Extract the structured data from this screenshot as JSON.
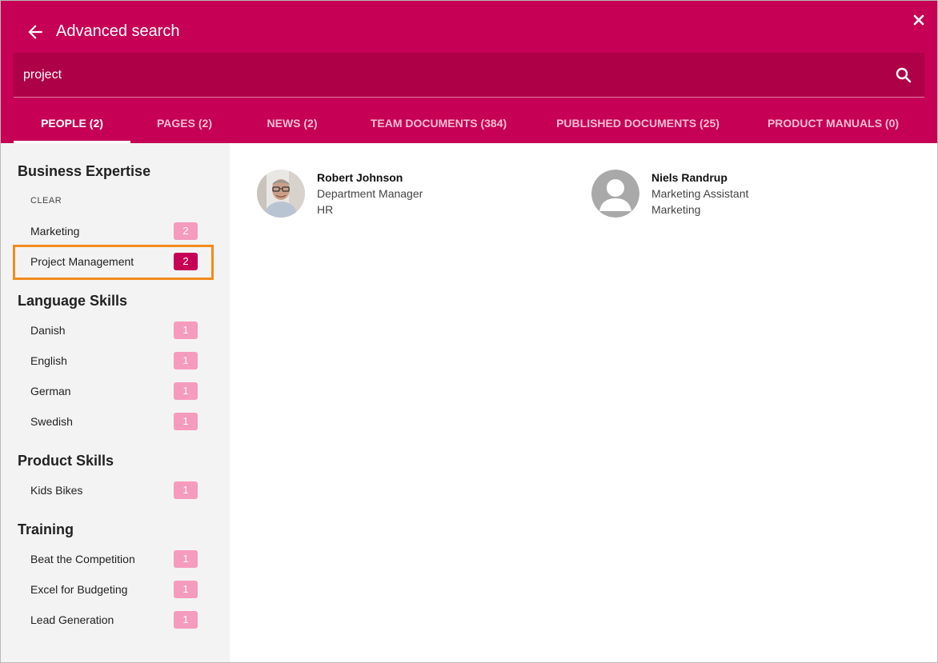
{
  "header": {
    "title": "Advanced search",
    "background_color": "#c50055",
    "back_icon": "arrow-left-icon",
    "close_icon": "close-icon"
  },
  "search": {
    "value": "project",
    "icon": "search-icon"
  },
  "tabs": [
    {
      "label": "PEOPLE (2)",
      "active": true
    },
    {
      "label": "PAGES (2)",
      "active": false
    },
    {
      "label": "NEWS (2)",
      "active": false
    },
    {
      "label": "TEAM DOCUMENTS (384)",
      "active": false
    },
    {
      "label": "PUBLISHED DOCUMENTS (25)",
      "active": false
    },
    {
      "label": "PRODUCT MANUALS (0)",
      "active": false
    }
  ],
  "sidebar": {
    "clear_label": "CLEAR",
    "groups": [
      {
        "title": "Business Expertise",
        "items": [
          {
            "label": "Marketing",
            "count": "2"
          },
          {
            "label": "Project Management",
            "count": "2",
            "selected": true
          }
        ]
      },
      {
        "title": "Language Skills",
        "items": [
          {
            "label": "Danish",
            "count": "1"
          },
          {
            "label": "English",
            "count": "1"
          },
          {
            "label": "German",
            "count": "1"
          },
          {
            "label": "Swedish",
            "count": "1"
          }
        ]
      },
      {
        "title": "Product Skills",
        "items": [
          {
            "label": "Kids Bikes",
            "count": "1"
          }
        ]
      },
      {
        "title": "Training",
        "items": [
          {
            "label": "Beat the Competition",
            "count": "1"
          },
          {
            "label": "Excel for Budgeting",
            "count": "1"
          },
          {
            "label": "Lead Generation",
            "count": "1"
          }
        ]
      }
    ],
    "count_color": "#f59bbd",
    "selected_count_color": "#c50055",
    "highlight_color": "#f28b1c"
  },
  "results": [
    {
      "name": "Robert Johnson",
      "title": "Department Manager",
      "department": "HR",
      "avatar": "photo"
    },
    {
      "name": "Niels Randrup",
      "title": "Marketing Assistant",
      "department": "Marketing",
      "avatar": "person-placeholder-icon"
    }
  ]
}
